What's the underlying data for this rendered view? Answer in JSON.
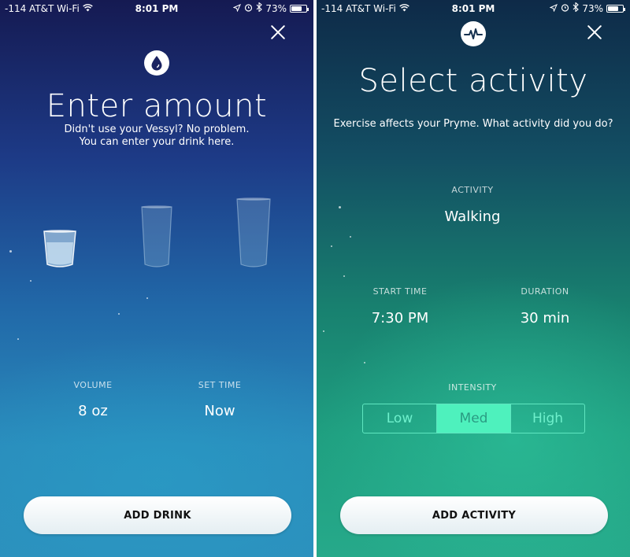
{
  "status_bar": {
    "carrier": "-114 AT&T Wi-Fi",
    "time": "8:01 PM",
    "battery": "73%",
    "battery_level": 0.73
  },
  "left_screen": {
    "title": "Enter amount",
    "subtitle_line1": "Didn't use your Vessyl? No problem.",
    "subtitle_line2": "You can enter your drink here.",
    "volume_label": "VOLUME",
    "volume_value": "8 oz",
    "set_time_label": "SET TIME",
    "set_time_value": "Now",
    "button_label": "ADD DRINK",
    "icon": "water-drop-icon"
  },
  "right_screen": {
    "title": "Select activity",
    "subtitle": "Exercise affects your Pryme. What activity did you do?",
    "activity_label": "ACTIVITY",
    "activity_value": "Walking",
    "start_time_label": "START TIME",
    "start_time_value": "7:30 PM",
    "duration_label": "DURATION",
    "duration_value": "30 min",
    "intensity_label": "INTENSITY",
    "intensity_options": [
      "Low",
      "Med",
      "High"
    ],
    "intensity_selected": "Med",
    "button_label": "ADD ACTIVITY",
    "icon": "heartbeat-icon"
  },
  "colors": {
    "accent_teal": "#4ef1bd",
    "left_bg_top": "#151a52",
    "right_bg_bottom": "#26a98a"
  }
}
